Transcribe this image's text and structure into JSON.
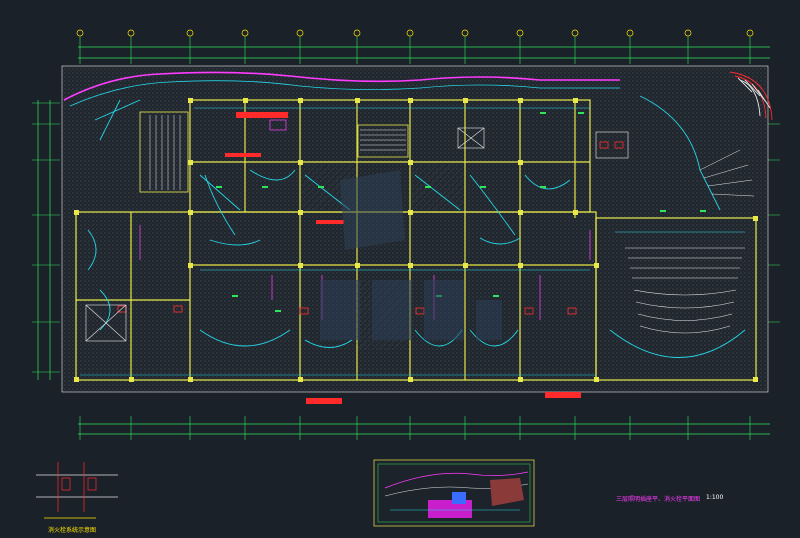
{
  "drawing": {
    "title": "三层照明插座平、消火栓平面图",
    "scale": "1:100",
    "detail_caption": "消火栓系统示意图"
  },
  "colors": {
    "background": "#1b2129",
    "wall": "#e8e84a",
    "axis": "#2ee65a",
    "cyan": "#24d6e6",
    "magenta": "#ff3cff",
    "red": "#ff2b2b",
    "white": "#e6e6e6",
    "blue": "#3a6cff"
  }
}
